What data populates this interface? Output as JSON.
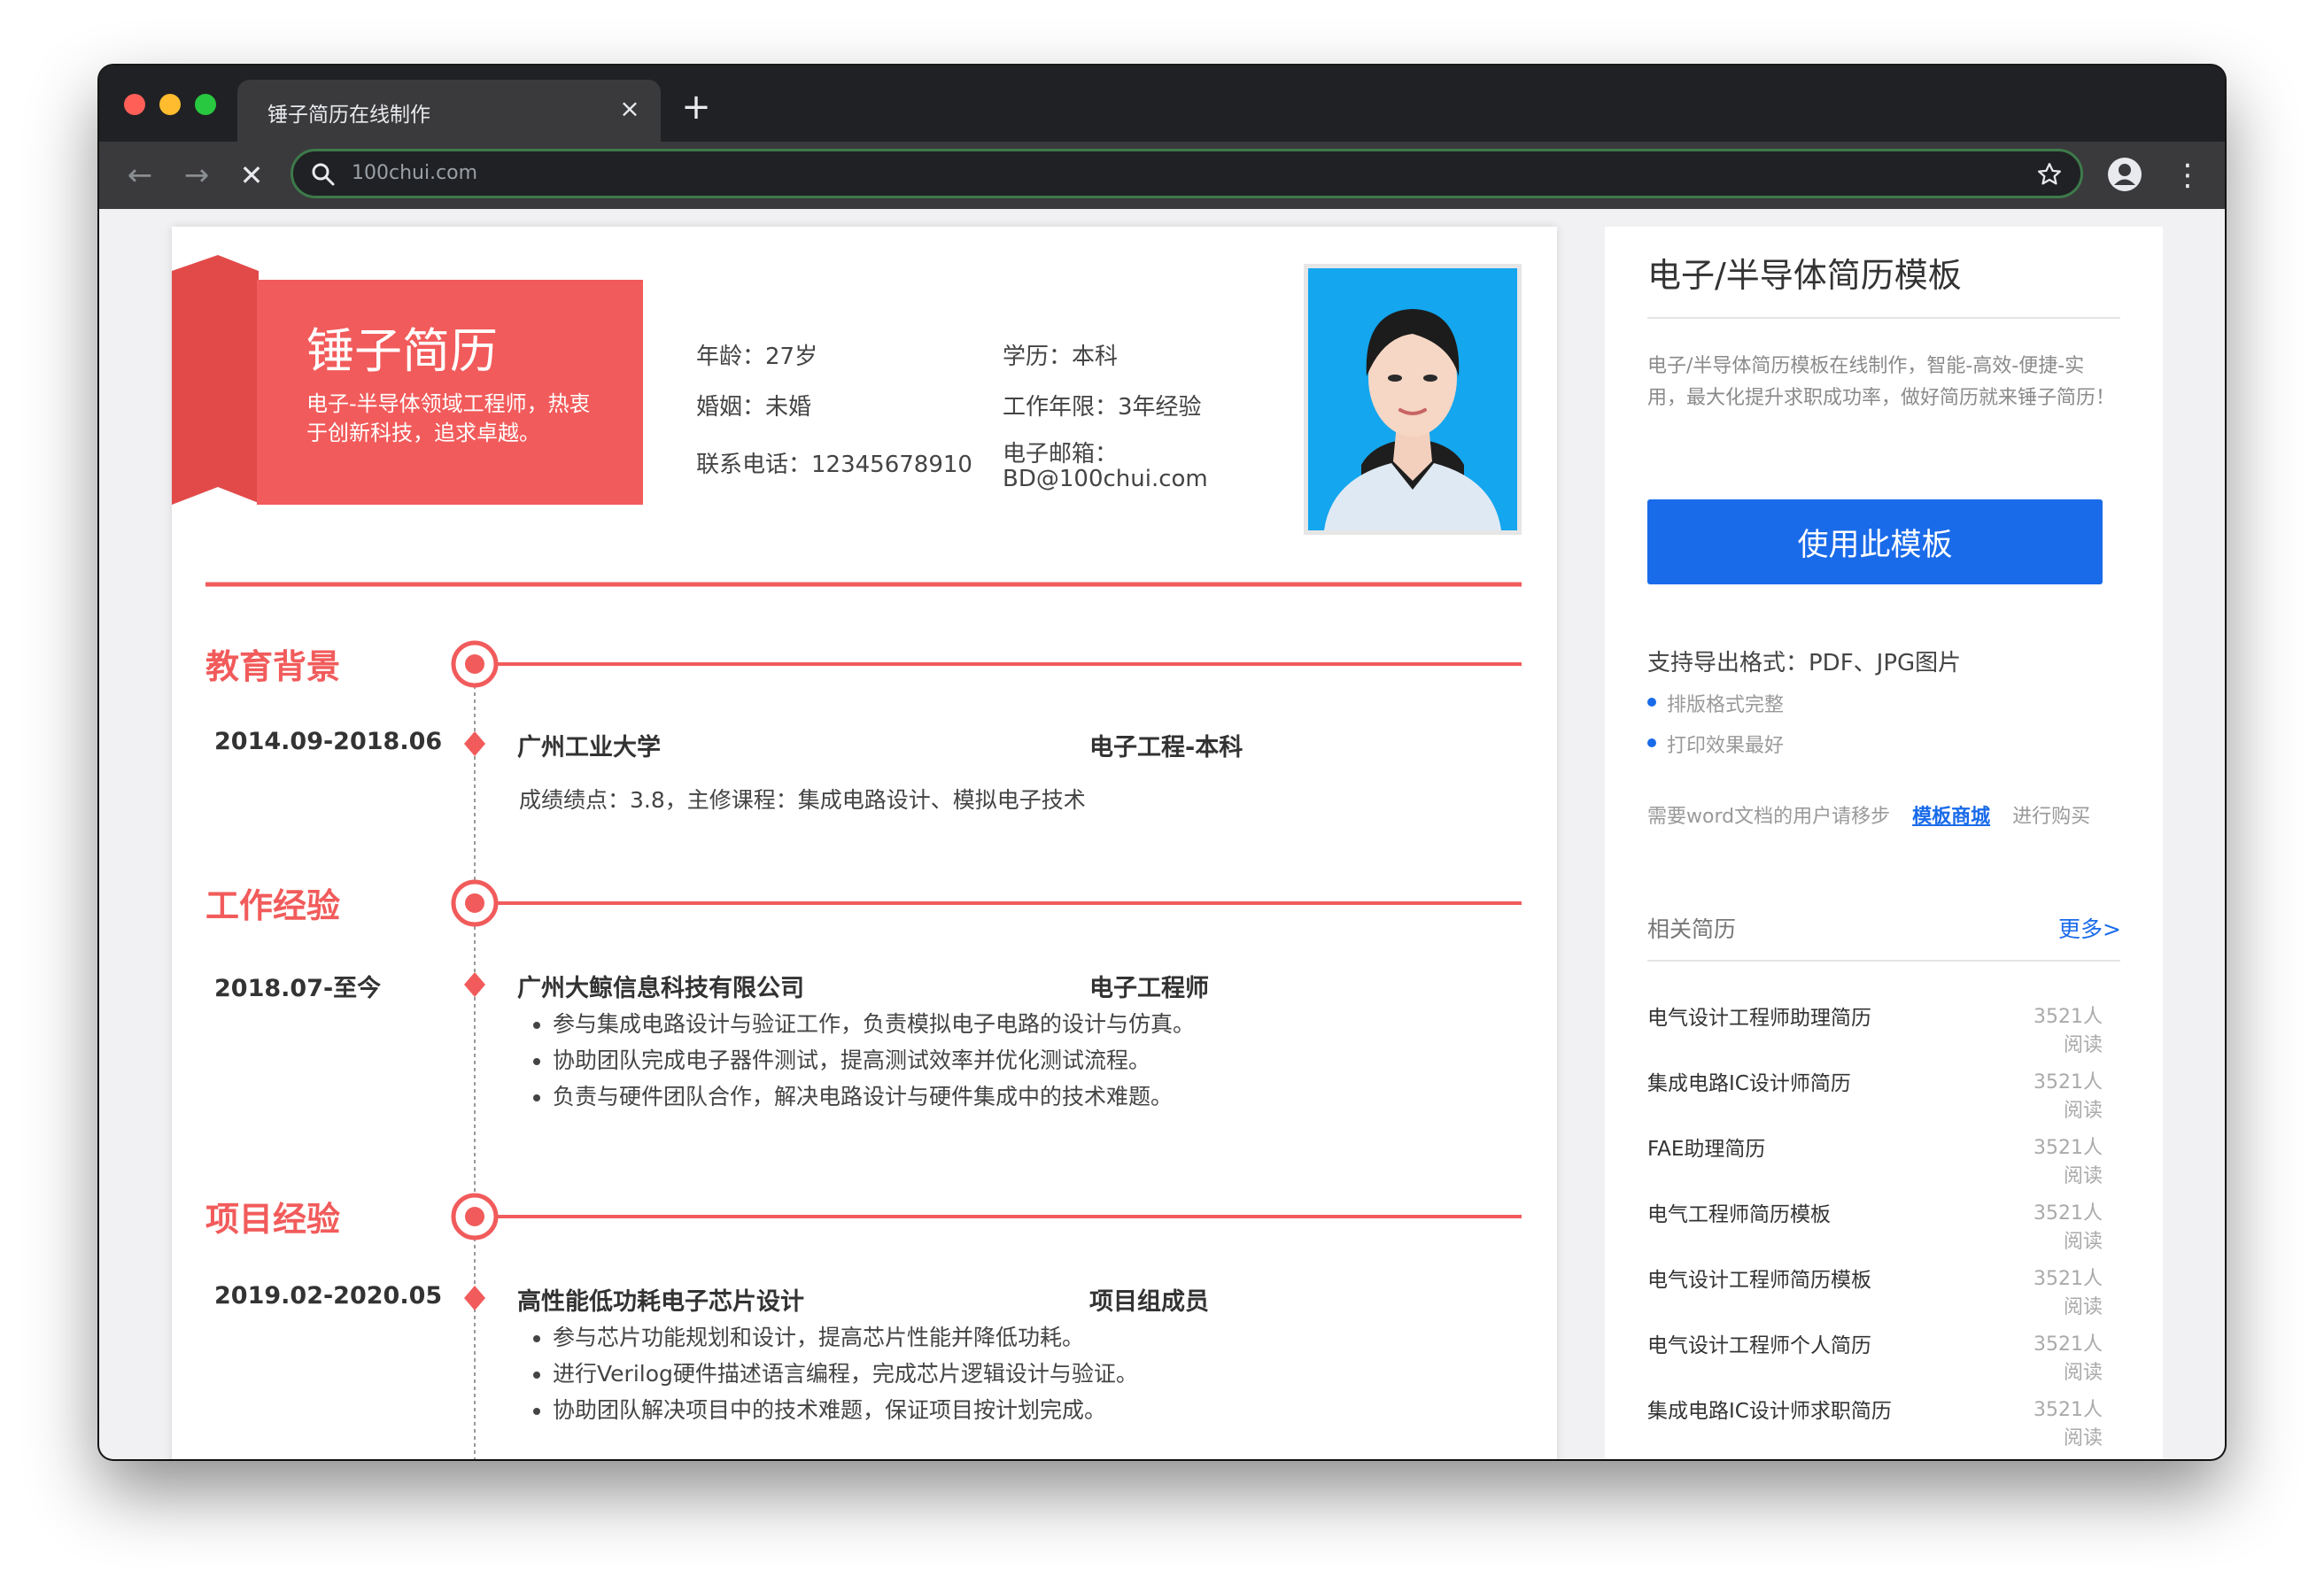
{
  "browser": {
    "tab_title": "锤子简历在线制作",
    "tab_close": "×",
    "new_tab": "+",
    "url": "100chui.com",
    "back": "←",
    "forward": "→",
    "stop": "✕",
    "menu": "⋮"
  },
  "resume": {
    "name": "锤子简历",
    "tagline": "电子-半导体领域工程师，热衷于创新科技，追求卓越。",
    "info": {
      "age": "年龄：27岁",
      "marriage": "婚姻：未婚",
      "phone": "联系电话：12345678910",
      "education": "学历：本科",
      "years": "工作年限：3年经验",
      "email_label": "电子邮箱：",
      "email": "BD@100chui.com"
    },
    "education": {
      "title": "教育背景",
      "date": "2014.09-2018.06",
      "school": "广州工业大学",
      "major": "电子工程-本科",
      "detail": "成绩绩点：3.8，主修课程：集成电路设计、模拟电子技术"
    },
    "work": {
      "title": "工作经验",
      "date": "2018.07-至今",
      "company": "广州大鲸信息科技有限公司",
      "position": "电子工程师",
      "bullets": [
        "参与集成电路设计与验证工作，负责模拟电子电路的设计与仿真。",
        "协助团队完成电子器件测试，提高测试效率并优化测试流程。",
        "负责与硬件团队合作，解决电路设计与硬件集成中的技术难题。"
      ]
    },
    "project": {
      "title": "项目经验",
      "date": "2019.02-2020.05",
      "name": "高性能低功耗电子芯片设计",
      "role": "项目组成员",
      "bullets": [
        "参与芯片功能规划和设计，提高芯片性能并降低功耗。",
        "进行Verilog硬件描述语言编程，完成芯片逻辑设计与验证。",
        "协助团队解决项目中的技术难题，保证项目按计划完成。"
      ]
    }
  },
  "sidebar": {
    "title": "电子/半导体简历模板",
    "description": "电子/半导体简历模板在线制作，智能-高效-便捷-实用，最大化提升求职成功率，做好简历就来锤子简历！",
    "use_button": "使用此模板",
    "formats": "支持导出格式：PDF、JPG图片",
    "features": [
      "排版格式完整",
      "打印效果最好"
    ],
    "word_note_prefix": "需要word文档的用户请移步",
    "word_link": "模板商城",
    "word_note_suffix": "进行购买",
    "related_title": "相关简历",
    "more": "更多>",
    "related": [
      {
        "name": "电气设计工程师助理简历",
        "reads": "3521人阅读"
      },
      {
        "name": "集成电路IC设计师简历",
        "reads": "3521人阅读"
      },
      {
        "name": "FAE助理简历",
        "reads": "3521人阅读"
      },
      {
        "name": "电气工程师简历模板",
        "reads": "3521人阅读"
      },
      {
        "name": "电气设计工程师简历模板",
        "reads": "3521人阅读"
      },
      {
        "name": "电气设计工程师个人简历",
        "reads": "3521人阅读"
      },
      {
        "name": "集成电路IC设计师求职简历",
        "reads": "3521人阅读"
      }
    ]
  },
  "colors": {
    "accent_red": "#f25b5b",
    "button_blue": "#1a6bea",
    "address_border": "#3d7a4a"
  }
}
